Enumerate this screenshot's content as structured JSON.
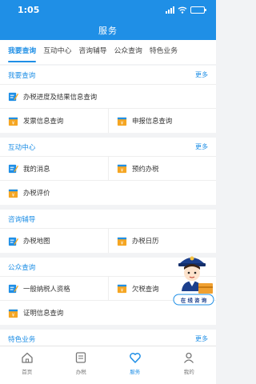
{
  "status_bar": {
    "time": "1:05"
  },
  "header": {
    "title": "服务"
  },
  "tabs": [
    {
      "label": "我要查询"
    },
    {
      "label": "互动中心"
    },
    {
      "label": "咨询辅导"
    },
    {
      "label": "公众查询"
    },
    {
      "label": "特色业务"
    }
  ],
  "sections": [
    {
      "title": "我要查询",
      "more": "更多",
      "items": [
        {
          "label": "办税进度及结果信息查询",
          "icon": "edit-icon"
        },
        {
          "label": "发票信息查询",
          "icon": "yuan-card-icon"
        },
        {
          "label": "申报信息查询",
          "icon": "yuan-card-icon"
        }
      ]
    },
    {
      "title": "互动中心",
      "more": "更多",
      "items": [
        {
          "label": "我的消息",
          "icon": "edit-icon"
        },
        {
          "label": "预约办税",
          "icon": "yuan-card-icon"
        },
        {
          "label": "办税评价",
          "icon": "yuan-card-icon"
        }
      ]
    },
    {
      "title": "咨询辅导",
      "items": [
        {
          "label": "办税地图",
          "icon": "edit-icon"
        },
        {
          "label": "办税日历",
          "icon": "yuan-card-icon"
        }
      ]
    },
    {
      "title": "公众查询",
      "items": [
        {
          "label": "一般纳税人资格",
          "icon": "edit-icon"
        },
        {
          "label": "欠税查询",
          "icon": "yuan-card-icon"
        },
        {
          "label": "证明信息查询",
          "icon": "yuan-card-icon"
        }
      ]
    },
    {
      "title": "特色业务",
      "more": "更多",
      "items": []
    }
  ],
  "mascot": {
    "caption": "在 线 咨 询"
  },
  "bottom_nav": [
    {
      "label": "首页",
      "icon": "home-icon"
    },
    {
      "label": "办税",
      "icon": "tax-doc-icon"
    },
    {
      "label": "服务",
      "icon": "heart-icon"
    },
    {
      "label": "我的",
      "icon": "user-icon"
    }
  ],
  "colors": {
    "primary": "#1f8fe6",
    "icon_orange": "#f5a623",
    "background": "#f2f3f5"
  }
}
